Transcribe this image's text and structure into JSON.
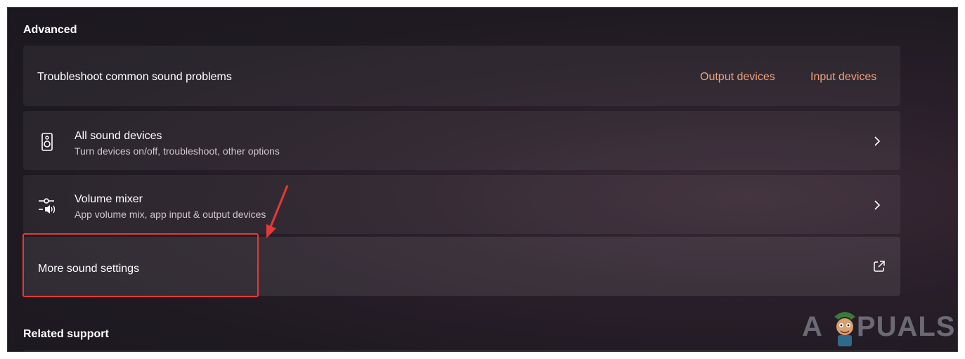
{
  "sections": {
    "advanced_title": "Advanced",
    "related_title": "Related support"
  },
  "troubleshoot": {
    "label": "Troubleshoot common sound problems",
    "output_link": "Output devices",
    "input_link": "Input devices"
  },
  "all_devices": {
    "title": "All sound devices",
    "subtitle": "Turn devices on/off, troubleshoot, other options",
    "icon": "speaker-icon"
  },
  "volume_mixer": {
    "title": "Volume mixer",
    "subtitle": "App volume mix, app input & output devices",
    "icon": "mixer-icon"
  },
  "more_sound": {
    "label": "More sound settings",
    "icon": "open-external-icon"
  },
  "watermark": {
    "text_left": "A",
    "text_right": "PUALS"
  },
  "colors": {
    "accent_link": "#f0a07a",
    "annotation_red": "#e53935"
  }
}
